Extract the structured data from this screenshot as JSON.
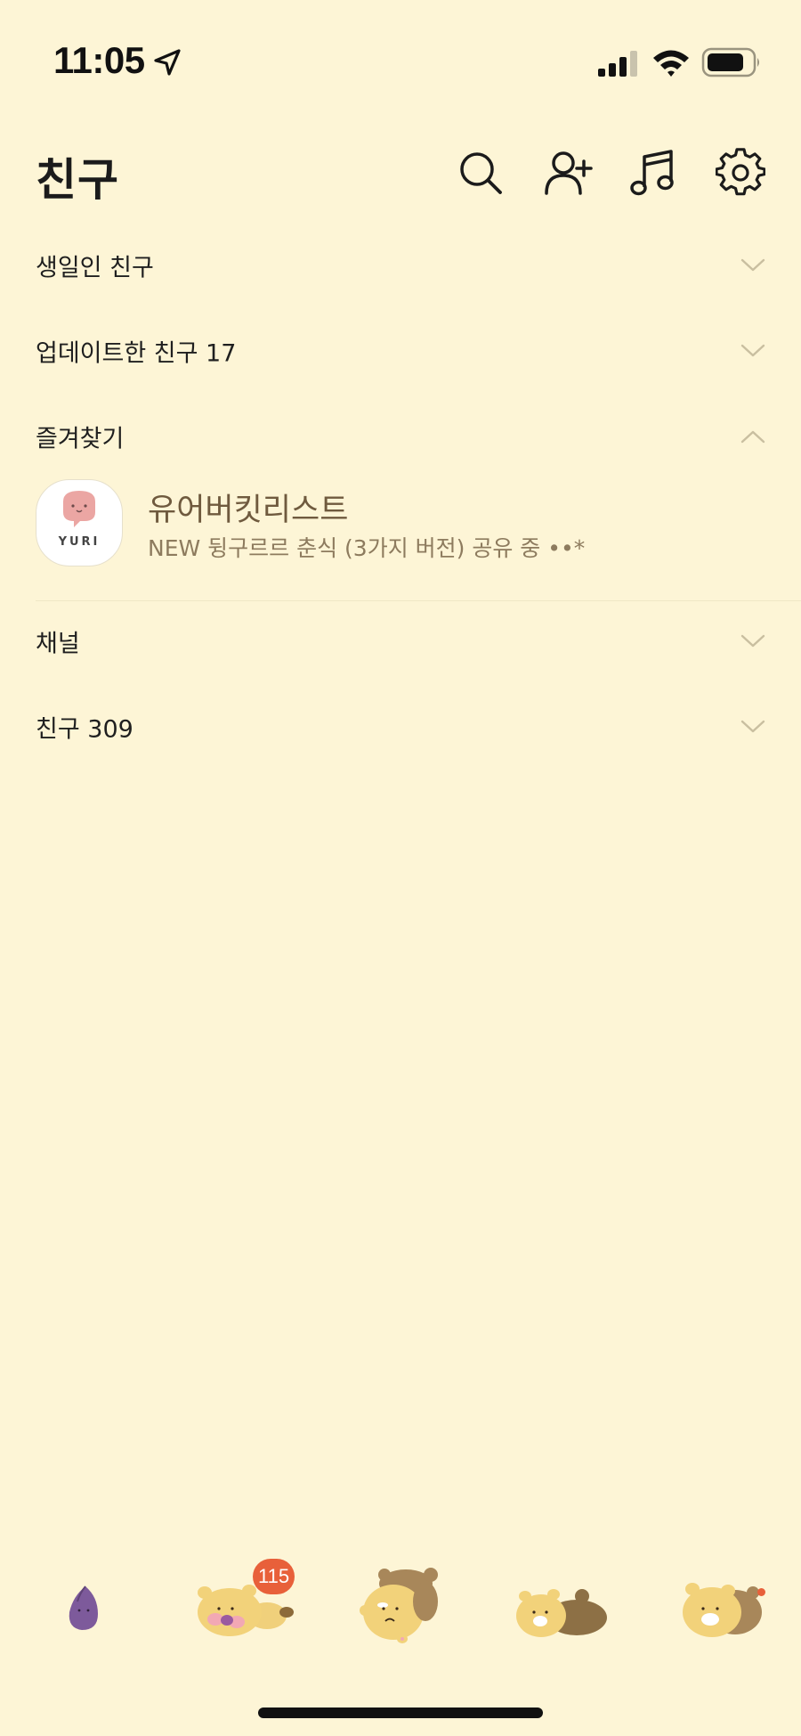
{
  "status_bar": {
    "time": "11:05",
    "icons": [
      "location-arrow-icon",
      "cellular-signal-icon",
      "wifi-icon",
      "battery-icon"
    ]
  },
  "header": {
    "title": "친구",
    "actions": [
      "search-icon",
      "add-friend-icon",
      "music-icon",
      "settings-icon"
    ]
  },
  "sections": {
    "birthday": {
      "label": "생일인 친구",
      "expanded": false
    },
    "updated": {
      "label": "업데이트한 친구 17",
      "expanded": false
    },
    "favorites": {
      "label": "즐겨찾기",
      "expanded": true
    },
    "channels": {
      "label": "채널",
      "expanded": false
    },
    "friends": {
      "label": "친구 309",
      "expanded": false
    }
  },
  "favorites": [
    {
      "name": "유어버킷리스트",
      "status": "NEW 뒹구르르 춘식 (3가지 버전) 공유 중 ••*",
      "avatar_logo_text": "YURI"
    }
  ],
  "tab_bar": {
    "tabs": [
      {
        "icon": "purple-sweet-potato-icon"
      },
      {
        "icon": "chunsik-lying-cheeks-icon",
        "badge": "115"
      },
      {
        "icon": "chunsik-ryan-hug-icon"
      },
      {
        "icon": "chunsik-lying-brown-blanket-icon"
      },
      {
        "icon": "chunsik-ryan-hood-icon",
        "dot": true
      }
    ],
    "badge_color": "#e8603a"
  },
  "colors": {
    "background": "#fdf5d6",
    "text": "#1d1d1d",
    "chevron": "#c9bfa0",
    "favorite_name": "#6f5a3e"
  }
}
